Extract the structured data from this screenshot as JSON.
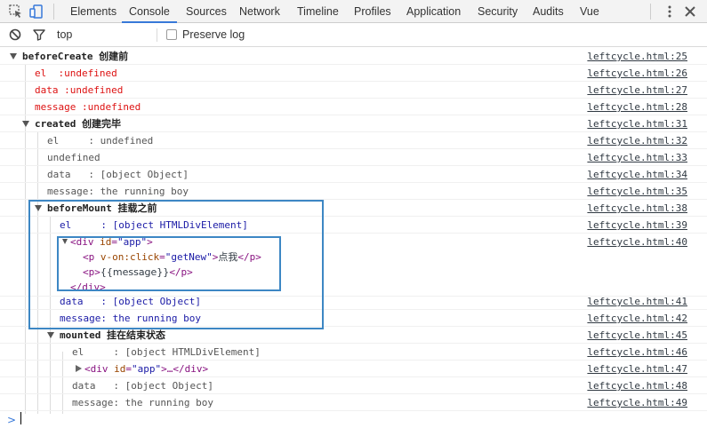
{
  "tabs": [
    "Elements",
    "Console",
    "Sources",
    "Network",
    "Timeline",
    "Profiles",
    "Application",
    "Security",
    "Audits",
    "Vue"
  ],
  "active_tab": "Console",
  "toolbar": {
    "context": "top",
    "preserve_log": "Preserve log"
  },
  "logs": {
    "beforeCreate": {
      "label": "beforeCreate",
      "cn": "创建前",
      "src": "leftcycle.html:25"
    },
    "bc_el": {
      "text": "el  :undefined",
      "src": "leftcycle.html:26"
    },
    "bc_data": {
      "text": "data :undefined",
      "src": "leftcycle.html:27"
    },
    "bc_message": {
      "text": "message :undefined",
      "src": "leftcycle.html:28"
    },
    "created": {
      "label": "created",
      "cn": "创建完毕",
      "src": "leftcycle.html:31"
    },
    "c_el": {
      "text": "el     : undefined",
      "src": "leftcycle.html:32"
    },
    "c_undef": {
      "text": "undefined",
      "src": "leftcycle.html:33"
    },
    "c_data": {
      "text": "data   : [object Object]",
      "src": "leftcycle.html:34"
    },
    "c_message": {
      "text": "message: the running boy",
      "src": "leftcycle.html:35"
    },
    "beforeMount": {
      "label": "beforeMount",
      "cn": "挂载之前",
      "src": "leftcycle.html:38"
    },
    "bm_el": {
      "text": "el     : [object HTMLDivElement]",
      "src": "leftcycle.html:39"
    },
    "bm_html": {
      "src": "leftcycle.html:40",
      "line1_tag_open": "<div ",
      "line1_attr": "id",
      "line1_val": "\"app\"",
      "line1_close": ">",
      "line2_tag_open": "<p ",
      "line2_attr": "v-on:click",
      "line2_val": "\"getNew\"",
      "line2_close": ">",
      "line2_text": "点我",
      "line2_end": "</p>",
      "line3_open": "<p>",
      "line3_text": "{{message}}",
      "line3_end": "</p>",
      "line4": "</div>"
    },
    "bm_data": {
      "text": "data   : [object Object]",
      "src": "leftcycle.html:41"
    },
    "bm_message": {
      "text": "message: the running boy",
      "src": "leftcycle.html:42"
    },
    "mounted": {
      "label": "mounted",
      "cn": "挂在结束状态",
      "src": "leftcycle.html:45"
    },
    "m_el": {
      "text": "el     : [object HTMLDivElement]",
      "src": "leftcycle.html:46"
    },
    "m_html": {
      "tag_open": "<div ",
      "attr": "id",
      "val": "\"app\"",
      "rest": ">…</div>",
      "src": "leftcycle.html:47"
    },
    "m_data": {
      "text": "data   : [object Object]",
      "src": "leftcycle.html:48"
    },
    "m_message": {
      "text": "message: the running boy",
      "src": "leftcycle.html:49"
    }
  },
  "colors": {
    "accent": "#3879d9",
    "highlight_box": "#3d87c4",
    "error_red": "#dd1111",
    "value_blue": "#1a1aa6"
  }
}
